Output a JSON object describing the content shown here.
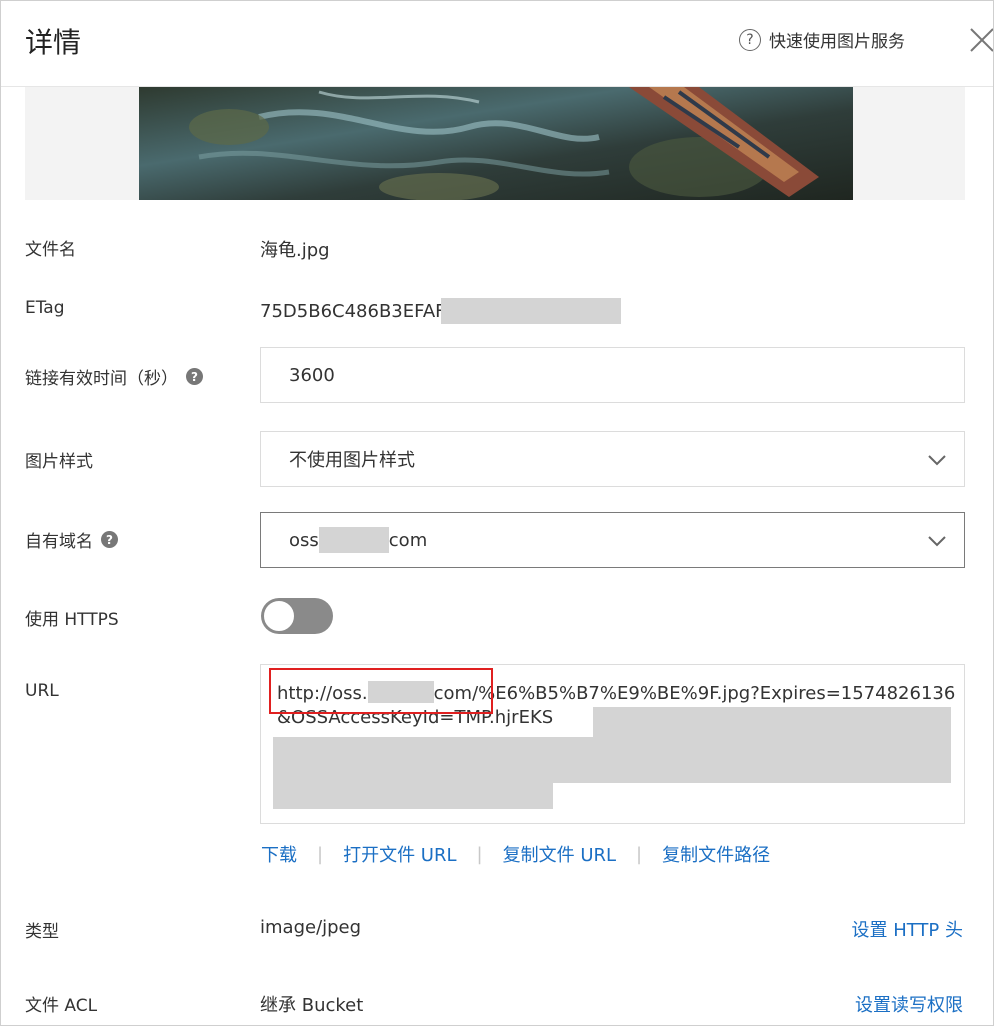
{
  "header": {
    "title": "详情",
    "help_link": "快速使用图片服务",
    "help_icon": "?"
  },
  "fields": {
    "filename": {
      "label": "文件名",
      "value": "海龟.jpg"
    },
    "etag": {
      "label": "ETag",
      "value": "75D5B6C486B3EFAF"
    },
    "expire": {
      "label": "链接有效时间（秒）",
      "value": "3600"
    },
    "style": {
      "label": "图片样式",
      "value": "不使用图片样式"
    },
    "domain": {
      "label": "自有域名",
      "value_prefix": "oss",
      "value_suffix": "com"
    },
    "https": {
      "label": "使用 HTTPS",
      "enabled": false
    },
    "url": {
      "label": "URL",
      "prefix": "http://oss.",
      "middle": "com/%E6%B5%B7%E9%BE%9F.jpg?Expires=1574826136&OSSAccessKeyId=TMP.hjrEKS"
    },
    "type": {
      "label": "类型",
      "value": "image/jpeg",
      "action": "设置 HTTP 头"
    },
    "acl": {
      "label": "文件 ACL",
      "value": "继承 Bucket",
      "action": "设置读写权限"
    }
  },
  "url_actions": {
    "download": "下载",
    "open": "打开文件 URL",
    "copy_url": "复制文件 URL",
    "copy_path": "复制文件路径"
  },
  "icons": {
    "help": "help-circle-icon",
    "close": "close-icon",
    "question": "question-icon",
    "chevron": "chevron-down-icon"
  }
}
